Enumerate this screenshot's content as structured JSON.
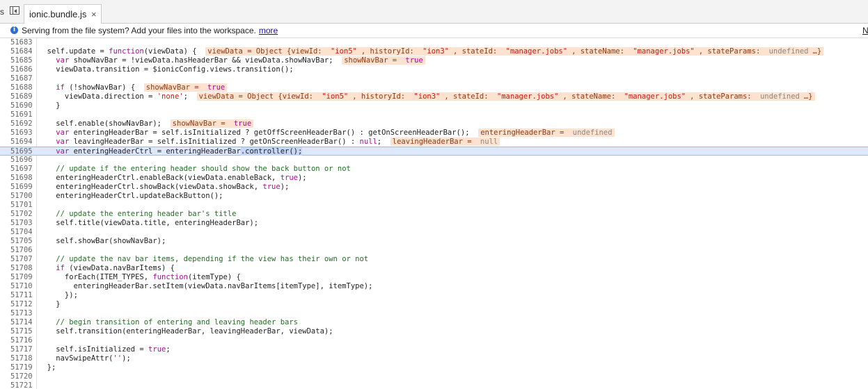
{
  "tabbar": {
    "edge_glyph": "s",
    "tab_label": "ionic.bundle.js",
    "close_glyph": "×"
  },
  "infobar": {
    "icon": "info-icon",
    "message": "Serving from the file system? Add your files into the workspace.",
    "link_text": "more",
    "right_text": "N"
  },
  "colors": {
    "highlight_line": "#dde8fb",
    "annotation_bg": "#fde2cf",
    "keyword": "#aa0d91",
    "string": "#c41a16",
    "comment": "#236e25"
  },
  "editor": {
    "highlighted_line": "51695",
    "lines": [
      {
        "n": "51683",
        "t": []
      },
      {
        "n": "51684",
        "t": [
          [
            "",
            "  self.update = "
          ],
          [
            "kw",
            "function"
          ],
          [
            "",
            "(viewData) {"
          ],
          [
            "annlead",
            "  "
          ],
          [
            "ann",
            "viewData = Object {viewId: "
          ],
          [
            "anns",
            "\"ion5\""
          ],
          [
            "ann",
            ", historyId: "
          ],
          [
            "anns",
            "\"ion3\""
          ],
          [
            "ann",
            ", stateId: "
          ],
          [
            "anns",
            "\"manager.jobs\""
          ],
          [
            "ann",
            ", stateName: "
          ],
          [
            "anns",
            "\"manager.jobs\""
          ],
          [
            "ann",
            ", stateParams: "
          ],
          [
            "annu",
            "undefined"
          ],
          [
            "ann",
            "…}"
          ]
        ]
      },
      {
        "n": "51685",
        "t": [
          [
            "",
            "    "
          ],
          [
            "kw",
            "var"
          ],
          [
            "",
            " showNavBar = !viewData.hasHeaderBar && viewData.showNavBar;"
          ],
          [
            "annlead",
            "  "
          ],
          [
            "ann",
            "showNavBar = "
          ],
          [
            "annt",
            "true"
          ]
        ]
      },
      {
        "n": "51686",
        "t": [
          [
            "",
            "    viewData.transition = $ionicConfig.views.transition();"
          ]
        ]
      },
      {
        "n": "51687",
        "t": []
      },
      {
        "n": "51688",
        "t": [
          [
            "",
            "    "
          ],
          [
            "kw",
            "if"
          ],
          [
            "",
            " (!showNavBar) {"
          ],
          [
            "annlead",
            "  "
          ],
          [
            "ann",
            "showNavBar = "
          ],
          [
            "annt",
            "true"
          ]
        ]
      },
      {
        "n": "51689",
        "t": [
          [
            "",
            "      viewData.direction = "
          ],
          [
            "str",
            "'none'"
          ],
          [
            "",
            ";"
          ],
          [
            "annlead",
            "  "
          ],
          [
            "ann",
            "viewData = Object {viewId: "
          ],
          [
            "anns",
            "\"ion5\""
          ],
          [
            "ann",
            ", historyId: "
          ],
          [
            "anns",
            "\"ion3\""
          ],
          [
            "ann",
            ", stateId: "
          ],
          [
            "anns",
            "\"manager.jobs\""
          ],
          [
            "ann",
            ", stateName: "
          ],
          [
            "anns",
            "\"manager.jobs\""
          ],
          [
            "ann",
            ", stateParams: "
          ],
          [
            "annu",
            "undefined"
          ],
          [
            "ann",
            "…}"
          ]
        ]
      },
      {
        "n": "51690",
        "t": [
          [
            "",
            "    }"
          ]
        ]
      },
      {
        "n": "51691",
        "t": []
      },
      {
        "n": "51692",
        "t": [
          [
            "",
            "    self.enable(showNavBar);"
          ],
          [
            "annlead",
            "  "
          ],
          [
            "ann",
            "showNavBar = "
          ],
          [
            "annt",
            "true"
          ]
        ]
      },
      {
        "n": "51693",
        "t": [
          [
            "",
            "    "
          ],
          [
            "kw",
            "var"
          ],
          [
            "",
            " enteringHeaderBar = self.isInitialized ? getOffScreenHeaderBar() : getOnScreenHeaderBar();"
          ],
          [
            "annlead",
            "  "
          ],
          [
            "ann",
            "enteringHeaderBar = "
          ],
          [
            "annu",
            "undefined"
          ]
        ]
      },
      {
        "n": "51694",
        "t": [
          [
            "",
            "    "
          ],
          [
            "kw",
            "var"
          ],
          [
            "",
            " leavingHeaderBar = self.isInitialized ? getOnScreenHeaderBar() : "
          ],
          [
            "kw",
            "null"
          ],
          [
            "",
            ";"
          ],
          [
            "annlead",
            "  "
          ],
          [
            "ann",
            "leavingHeaderBar = "
          ],
          [
            "annu",
            "null"
          ]
        ]
      },
      {
        "n": "51695",
        "t": [
          [
            "",
            "    "
          ],
          [
            "kw",
            "var"
          ],
          [
            "",
            " enteringHeaderCtrl = enteringHeaderBar"
          ],
          [
            "sel",
            ".controller();"
          ]
        ]
      },
      {
        "n": "51696",
        "t": []
      },
      {
        "n": "51697",
        "t": [
          [
            "",
            "    "
          ],
          [
            "cm",
            "// update if the entering header should show the back button or not"
          ]
        ]
      },
      {
        "n": "51698",
        "t": [
          [
            "",
            "    enteringHeaderCtrl.enableBack(viewData.enableBack, "
          ],
          [
            "kw",
            "true"
          ],
          [
            "",
            ");"
          ]
        ]
      },
      {
        "n": "51699",
        "t": [
          [
            "",
            "    enteringHeaderCtrl.showBack(viewData.showBack, "
          ],
          [
            "kw",
            "true"
          ],
          [
            "",
            ");"
          ]
        ]
      },
      {
        "n": "51700",
        "t": [
          [
            "",
            "    enteringHeaderCtrl.updateBackButton();"
          ]
        ]
      },
      {
        "n": "51701",
        "t": []
      },
      {
        "n": "51702",
        "t": [
          [
            "",
            "    "
          ],
          [
            "cm",
            "// update the entering header bar's title"
          ]
        ]
      },
      {
        "n": "51703",
        "t": [
          [
            "",
            "    self.title(viewData.title, enteringHeaderBar);"
          ]
        ]
      },
      {
        "n": "51704",
        "t": []
      },
      {
        "n": "51705",
        "t": [
          [
            "",
            "    self.showBar(showNavBar);"
          ]
        ]
      },
      {
        "n": "51706",
        "t": []
      },
      {
        "n": "51707",
        "t": [
          [
            "",
            "    "
          ],
          [
            "cm",
            "// update the nav bar items, depending if the view has their own or not"
          ]
        ]
      },
      {
        "n": "51708",
        "t": [
          [
            "",
            "    "
          ],
          [
            "kw",
            "if"
          ],
          [
            "",
            " (viewData.navBarItems) {"
          ]
        ]
      },
      {
        "n": "51709",
        "t": [
          [
            "",
            "      forEach(ITEM_TYPES, "
          ],
          [
            "kw",
            "function"
          ],
          [
            "",
            "(itemType) {"
          ]
        ]
      },
      {
        "n": "51710",
        "t": [
          [
            "",
            "        enteringHeaderBar.setItem(viewData.navBarItems[itemType], itemType);"
          ]
        ]
      },
      {
        "n": "51711",
        "t": [
          [
            "",
            "      });"
          ]
        ]
      },
      {
        "n": "51712",
        "t": [
          [
            "",
            "    }"
          ]
        ]
      },
      {
        "n": "51713",
        "t": []
      },
      {
        "n": "51714",
        "t": [
          [
            "",
            "    "
          ],
          [
            "cm",
            "// begin transition of entering and leaving header bars"
          ]
        ]
      },
      {
        "n": "51715",
        "t": [
          [
            "",
            "    self.transition(enteringHeaderBar, leavingHeaderBar, viewData);"
          ]
        ]
      },
      {
        "n": "51716",
        "t": []
      },
      {
        "n": "51717",
        "t": [
          [
            "",
            "    self.isInitialized = "
          ],
          [
            "kw",
            "true"
          ],
          [
            "",
            ";"
          ]
        ]
      },
      {
        "n": "51718",
        "t": [
          [
            "",
            "    navSwipeAttr("
          ],
          [
            "str",
            "''"
          ],
          [
            "",
            ");"
          ]
        ]
      },
      {
        "n": "51719",
        "t": [
          [
            "",
            "  };"
          ]
        ]
      },
      {
        "n": "51720",
        "t": []
      },
      {
        "n": "51721",
        "t": []
      }
    ]
  }
}
